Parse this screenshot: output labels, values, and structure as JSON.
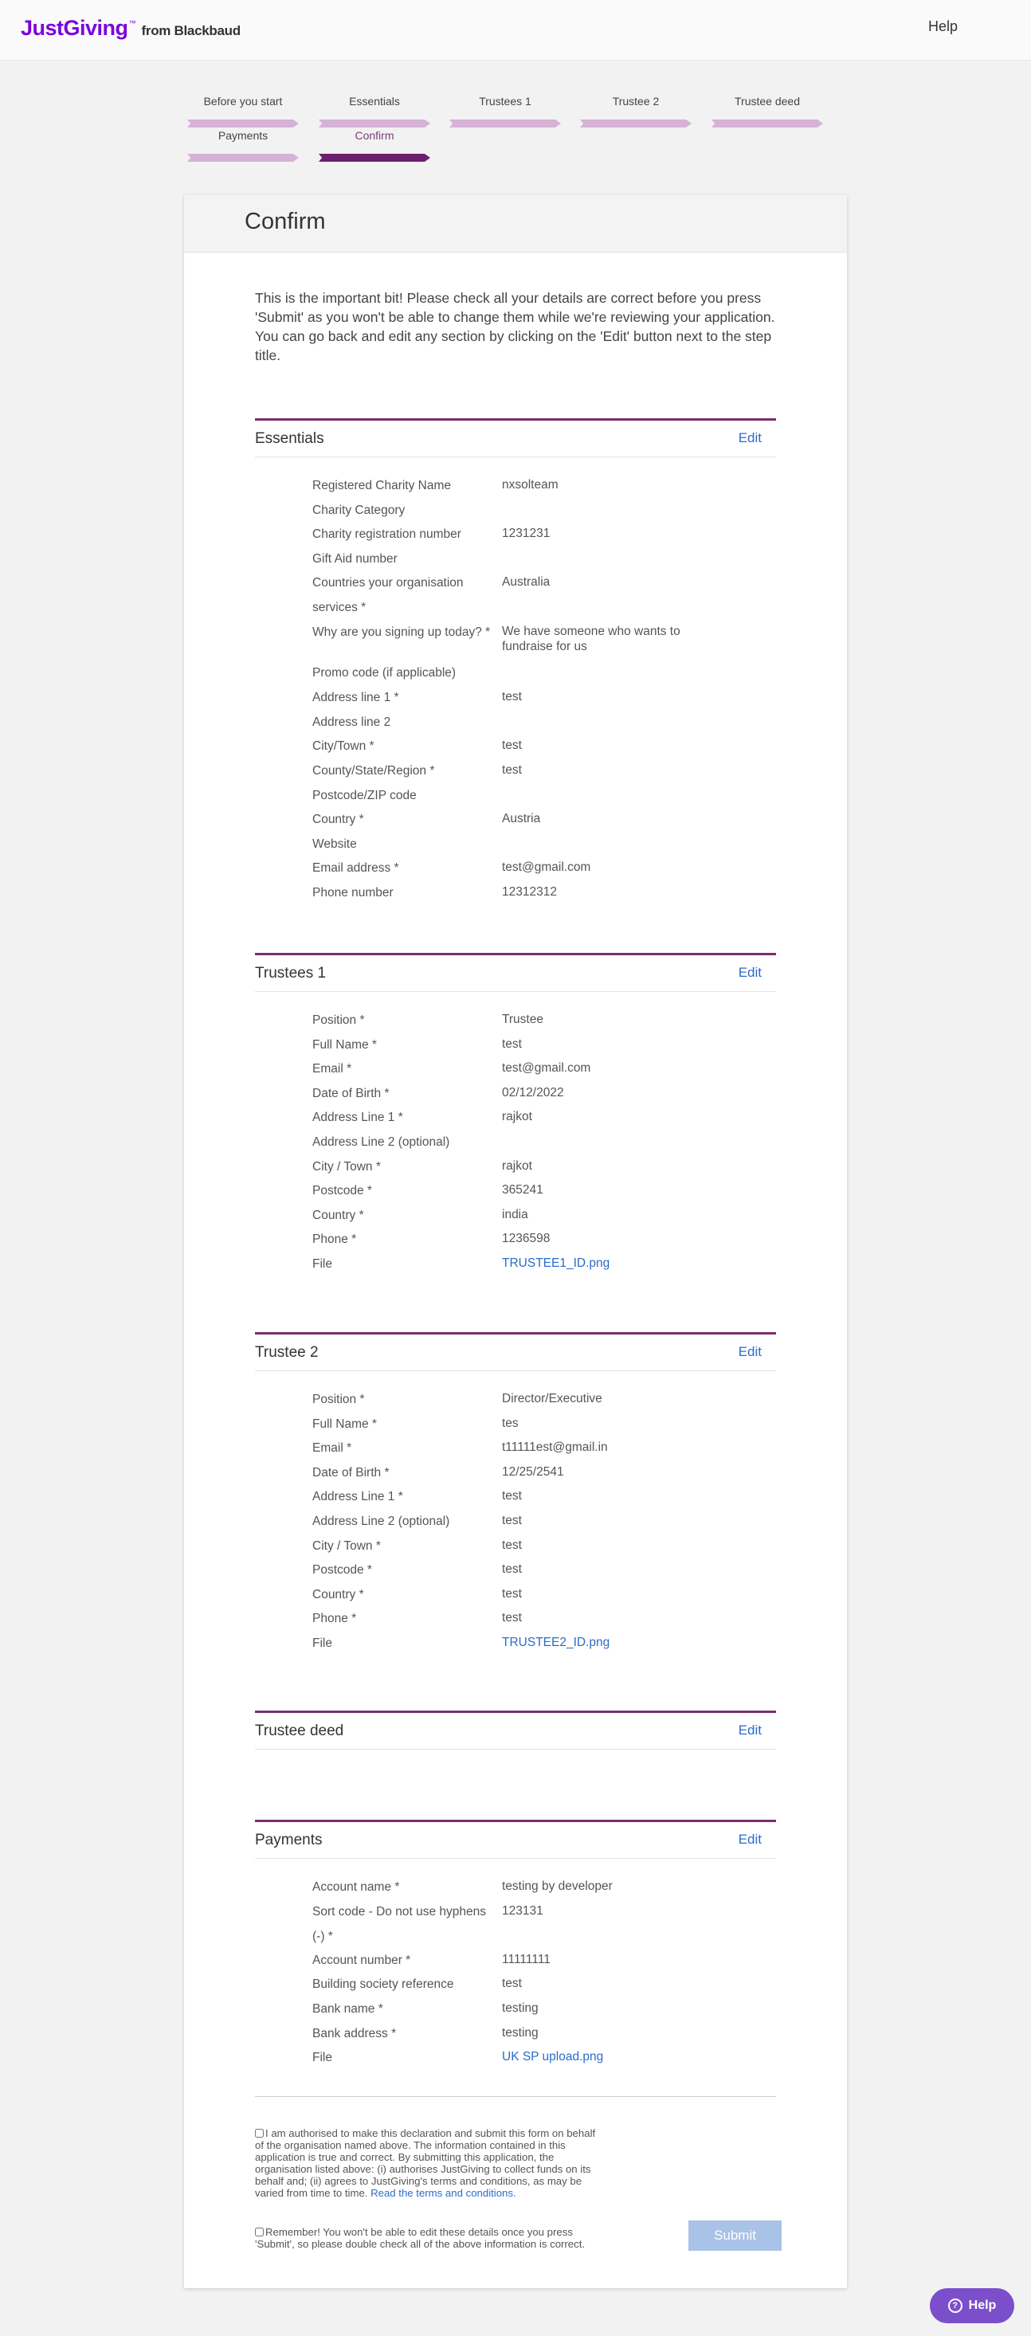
{
  "header": {
    "logo_main": "JustGiving",
    "logo_tm": "™",
    "logo_from": "from Blackbaud",
    "help": "Help"
  },
  "steps": [
    {
      "label": "Before you start",
      "state": "done"
    },
    {
      "label": "Essentials",
      "state": "done"
    },
    {
      "label": "Trustees 1",
      "state": "done"
    },
    {
      "label": "Trustee 2",
      "state": "done"
    },
    {
      "label": "Trustee deed",
      "state": "done"
    },
    {
      "label": "Payments",
      "state": "done"
    },
    {
      "label": "Confirm",
      "state": "active"
    }
  ],
  "page": {
    "title": "Confirm",
    "intro": "This is the important bit! Please check all your details are correct before you press 'Submit' as you won't be able to change them while we're reviewing your application. You can go back and edit any section by clicking on the 'Edit' button next to the step title.",
    "edit": "Edit"
  },
  "essentials": {
    "title": "Essentials",
    "rows": [
      {
        "label": "Registered Charity Name",
        "value": "nxsolteam"
      },
      {
        "label": "Charity Category",
        "value": ""
      },
      {
        "label": "Charity registration number",
        "value": "1231231"
      },
      {
        "label": "Gift Aid number",
        "value": ""
      },
      {
        "label": "Countries your organisation services *",
        "value": "Australia"
      },
      {
        "label": "Why are you signing up today? *",
        "value": "We have someone who wants to fundraise for us"
      },
      {
        "label": "Promo code (if applicable)",
        "value": ""
      },
      {
        "label": "Address line 1 *",
        "value": "test"
      },
      {
        "label": "Address line 2",
        "value": ""
      },
      {
        "label": "City/Town *",
        "value": "test"
      },
      {
        "label": "County/State/Region *",
        "value": "test"
      },
      {
        "label": "Postcode/ZIP code",
        "value": ""
      },
      {
        "label": "Country *",
        "value": "Austria"
      },
      {
        "label": "Website",
        "value": ""
      },
      {
        "label": "Email address *",
        "value": "test@gmail.com"
      },
      {
        "label": "Phone number",
        "value": "12312312"
      }
    ]
  },
  "trustees1": {
    "title": "Trustees 1",
    "rows": [
      {
        "label": "Position *",
        "value": "Trustee"
      },
      {
        "label": "Full Name *",
        "value": "test"
      },
      {
        "label": "Email *",
        "value": "test@gmail.com"
      },
      {
        "label": "Date of Birth *",
        "value": "02/12/2022"
      },
      {
        "label": "Address Line 1 *",
        "value": "rajkot"
      },
      {
        "label": "Address Line 2 (optional)",
        "value": ""
      },
      {
        "label": "City / Town *",
        "value": "rajkot"
      },
      {
        "label": "Postcode *",
        "value": "365241"
      },
      {
        "label": "Country *",
        "value": "india"
      },
      {
        "label": "Phone *",
        "value": "1236598"
      },
      {
        "label": "File",
        "value": "TRUSTEE1_ID.png",
        "link": true
      }
    ]
  },
  "trustee2": {
    "title": "Trustee 2",
    "rows": [
      {
        "label": "Position *",
        "value": "Director/Executive"
      },
      {
        "label": "Full Name *",
        "value": "tes"
      },
      {
        "label": "Email *",
        "value": "t11111est@gmail.in"
      },
      {
        "label": "Date of Birth *",
        "value": "12/25/2541"
      },
      {
        "label": "Address Line 1 *",
        "value": "test"
      },
      {
        "label": "Address Line 2 (optional)",
        "value": "test"
      },
      {
        "label": "City / Town *",
        "value": "test"
      },
      {
        "label": "Postcode *",
        "value": "test"
      },
      {
        "label": "Country *",
        "value": "test"
      },
      {
        "label": "Phone *",
        "value": "test"
      },
      {
        "label": "File",
        "value": "TRUSTEE2_ID.png",
        "link": true
      }
    ]
  },
  "trustee_deed": {
    "title": "Trustee deed"
  },
  "payments": {
    "title": "Payments",
    "rows": [
      {
        "label": "Account name *",
        "value": "testing by developer"
      },
      {
        "label": "Sort code - Do not use hyphens (-) *",
        "value": "123131"
      },
      {
        "label": "Account number *",
        "value": "11111111"
      },
      {
        "label": "Building society reference",
        "value": "test"
      },
      {
        "label": "Bank name *",
        "value": "testing"
      },
      {
        "label": "Bank address *",
        "value": "testing"
      },
      {
        "label": "File",
        "value": "UK SP upload.png",
        "link": true
      }
    ]
  },
  "declaration": {
    "authorise_text": "I am authorised to make this declaration and submit this form on behalf of the organisation named above. The information contained in this application is true and correct. By submitting this application, the organisation listed above: (i) authorises JustGiving to collect funds on its behalf and; (ii) agrees to JustGiving's terms and conditions, as may be varied from time to time.",
    "terms_link": "Read the terms and conditions.",
    "remember_text": "Remember! You won't be able to edit these details once you press 'Submit', so please double check all of the above information is correct.",
    "submit": "Submit"
  },
  "help_button": {
    "icon": "question-circle-icon",
    "label": "Help"
  },
  "colors": {
    "brand": "#7a04dd",
    "section_rule": "#7b2d6d",
    "step_done": "#d5b2d6",
    "step_active": "#6d1e6c",
    "link": "#2c6cc9",
    "submit_disabled": "#a9c2e7",
    "help_fab": "#7b4fcb"
  }
}
